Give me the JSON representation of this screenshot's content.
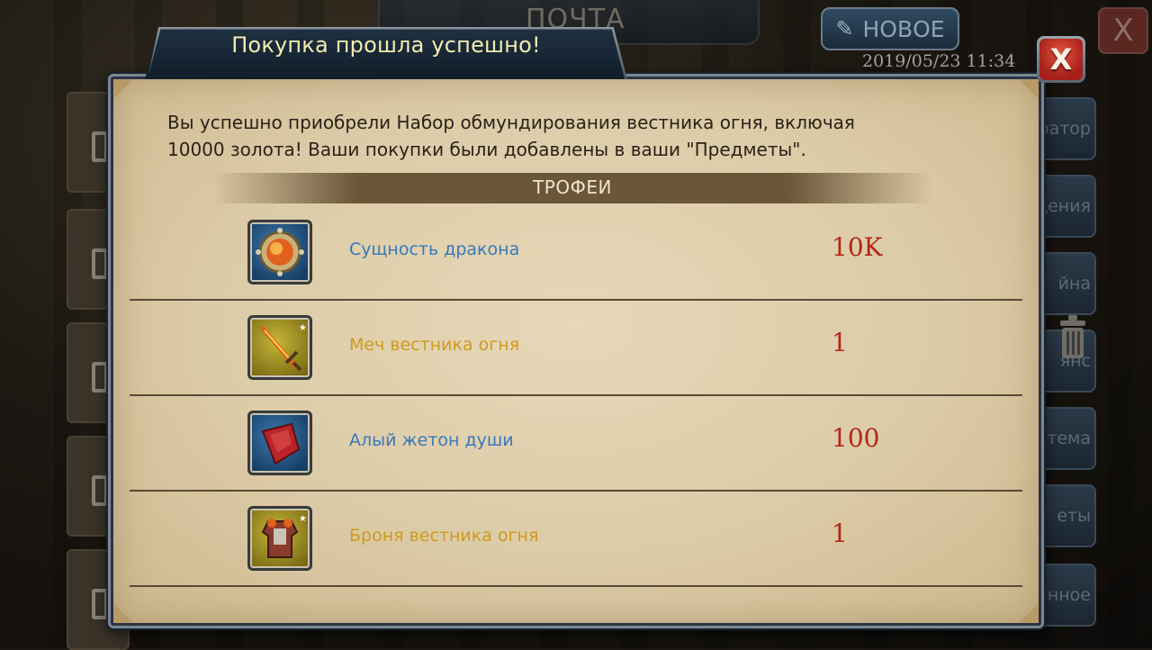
{
  "background": {
    "window_title": "ПОЧТА",
    "new_button_label": "НОВОЕ",
    "timestamp": "2019/05/23 11:34",
    "close_glyph": "X",
    "side_tabs": [
      "ратор",
      "щения",
      "йна",
      "янс",
      "тема",
      "еты",
      "анное"
    ]
  },
  "popup": {
    "title": "Покупка прошла успешно!",
    "close_glyph": "X",
    "message_line1": "Вы успешно приобрели Набор обмундирования вестника огня, включая",
    "message_line2": "10000 золота! Ваши покупки были добавлены в ваши \"Предметы\".",
    "section_title": "ТРОФЕИ",
    "rewards": [
      {
        "name": "Сущность дракона",
        "quantity": "10K",
        "icon": "dragon-essence-icon",
        "rarity_color": "#3a78b8"
      },
      {
        "name": "Меч вестника огня",
        "quantity": "1",
        "icon": "fire-sword-icon",
        "rarity_color": "#cf9a1d"
      },
      {
        "name": "Алый жетон души",
        "quantity": "100",
        "icon": "crimson-soul-token-icon",
        "rarity_color": "#3a78b8"
      },
      {
        "name": "Броня вестника огня",
        "quantity": "1",
        "icon": "fire-armor-icon",
        "rarity_color": "#cf9a1d"
      }
    ]
  }
}
